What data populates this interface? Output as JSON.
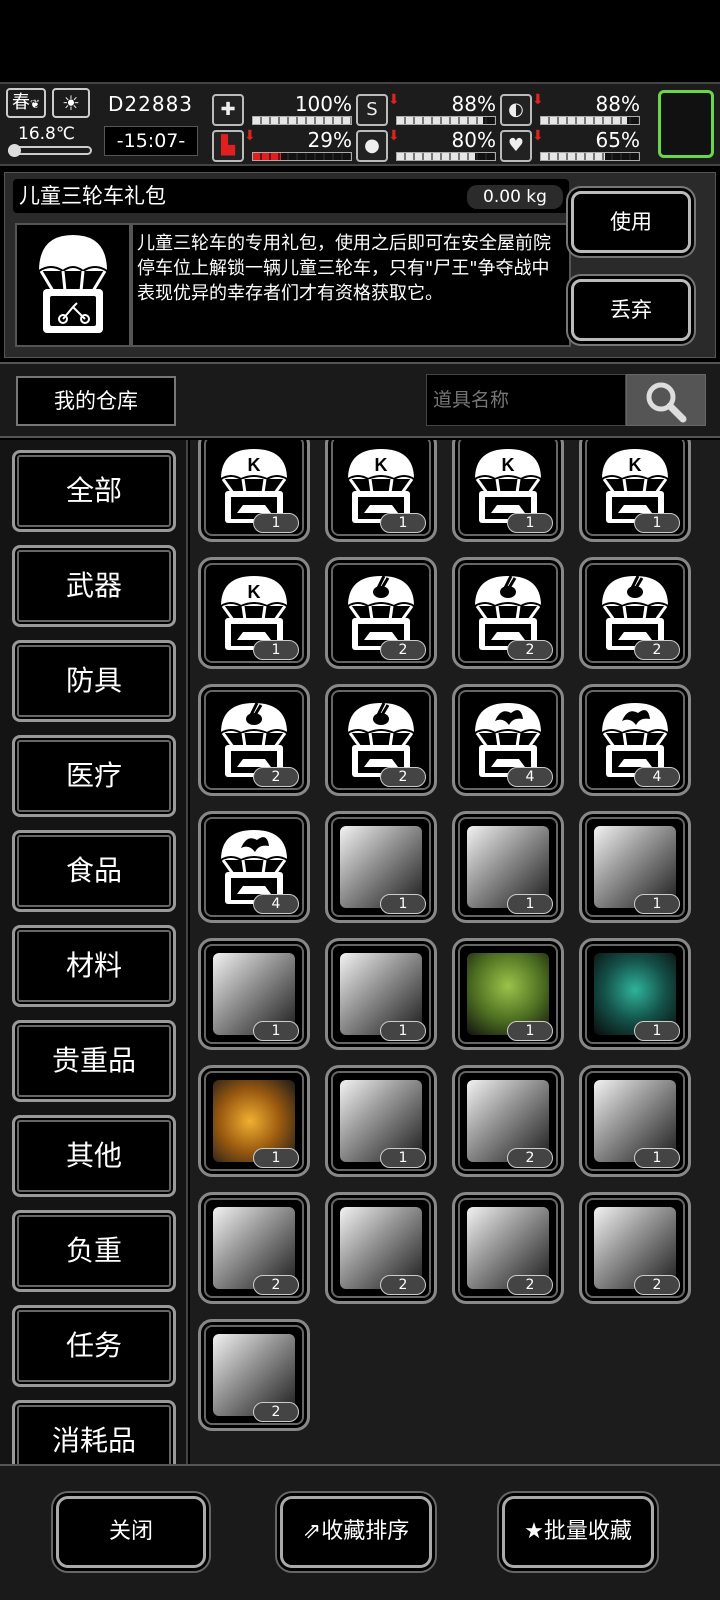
{
  "status": {
    "season": "春",
    "weather_icon": "sun-icon",
    "temperature": "16.8℃",
    "day": "D22883",
    "time": "-15:07-",
    "meters": [
      {
        "name": "health",
        "icon": "medkit-icon",
        "value": "100%",
        "fill": 1.0,
        "down": false,
        "red": false
      },
      {
        "name": "hunger",
        "icon": "stomach-icon",
        "value": "88%",
        "fill": 0.88,
        "down": true,
        "red": false
      },
      {
        "name": "stamina",
        "icon": "pill-icon",
        "value": "88%",
        "fill": 0.88,
        "down": true,
        "red": false
      },
      {
        "name": "leg",
        "icon": "boot-icon",
        "value": "29%",
        "fill": 0.29,
        "down": true,
        "red": true
      },
      {
        "name": "thirst",
        "icon": "water-drop-icon",
        "value": "80%",
        "fill": 0.8,
        "down": true,
        "red": false
      },
      {
        "name": "mood",
        "icon": "heart-icon",
        "value": "65%",
        "fill": 0.65,
        "down": true,
        "red": false
      }
    ]
  },
  "detail": {
    "title": "儿童三轮车礼包",
    "weight": "0.00 kg",
    "description": "儿童三轮车的专用礼包，使用之后即可在安全屋前院停车位上解锁一辆儿童三轮车，只有\"尸王\"争夺战中表现优异的幸存者们才有资格获取它。",
    "use_label": "使用",
    "drop_label": "丢弃"
  },
  "search": {
    "warehouse_label": "我的仓库",
    "placeholder": "道具名称"
  },
  "categories": [
    "全部",
    "武器",
    "防具",
    "医疗",
    "食品",
    "材料",
    "贵重品",
    "其他",
    "负重",
    "任务",
    "消耗品"
  ],
  "items": [
    {
      "kind": "crate-k",
      "qty": "1"
    },
    {
      "kind": "crate-k",
      "qty": "1"
    },
    {
      "kind": "crate-k",
      "qty": "1"
    },
    {
      "kind": "crate-k",
      "qty": "1"
    },
    {
      "kind": "crate-k",
      "qty": "1"
    },
    {
      "kind": "crate-rabbit",
      "qty": "2"
    },
    {
      "kind": "crate-rabbit",
      "qty": "2"
    },
    {
      "kind": "crate-rabbit",
      "qty": "2"
    },
    {
      "kind": "crate-rabbit",
      "qty": "2"
    },
    {
      "kind": "crate-rabbit",
      "qty": "2"
    },
    {
      "kind": "crate-dragon",
      "qty": "4"
    },
    {
      "kind": "crate-dragon",
      "qty": "4"
    },
    {
      "kind": "crate-dragon",
      "qty": "4"
    },
    {
      "kind": "vehicle",
      "qty": "1"
    },
    {
      "kind": "vehicle",
      "qty": "1"
    },
    {
      "kind": "vehicle",
      "qty": "1"
    },
    {
      "kind": "vehicle",
      "qty": "1"
    },
    {
      "kind": "vehicle",
      "qty": "1"
    },
    {
      "kind": "vehicle-green",
      "qty": "1"
    },
    {
      "kind": "vehicle-teal",
      "qty": "1"
    },
    {
      "kind": "vehicle-gold",
      "qty": "1"
    },
    {
      "kind": "vehicle",
      "qty": "1"
    },
    {
      "kind": "vehicle",
      "qty": "2"
    },
    {
      "kind": "vehicle",
      "qty": "1"
    },
    {
      "kind": "vehicle",
      "qty": "2"
    },
    {
      "kind": "vehicle",
      "qty": "2"
    },
    {
      "kind": "vehicle",
      "qty": "2"
    },
    {
      "kind": "vehicle",
      "qty": "2"
    },
    {
      "kind": "vehicle",
      "qty": "2"
    }
  ],
  "bottom": {
    "close_label": "关闭",
    "sort_label": "收藏排序",
    "batch_label": "批量收藏"
  }
}
